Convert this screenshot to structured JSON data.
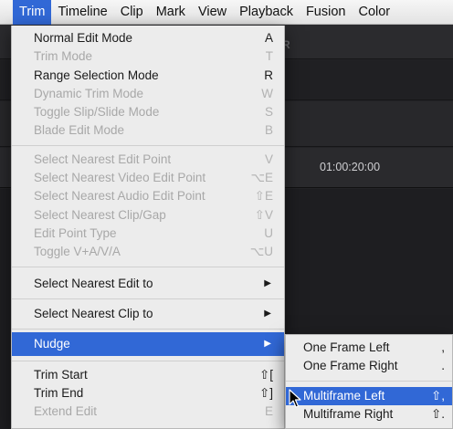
{
  "menubar": {
    "items": [
      "Trim",
      "Timeline",
      "Clip",
      "Mark",
      "View",
      "Playback",
      "Fusion",
      "Color"
    ],
    "active": "Trim"
  },
  "background": {
    "partial_label": "R",
    "timecode": "01:00:20:00"
  },
  "trim_menu": {
    "group1": [
      {
        "label": "Normal Edit Mode",
        "shortcut": "A",
        "enabled": true
      },
      {
        "label": "Trim Mode",
        "shortcut": "T",
        "enabled": false
      },
      {
        "label": "Range Selection Mode",
        "shortcut": "R",
        "enabled": true
      },
      {
        "label": "Dynamic Trim Mode",
        "shortcut": "W",
        "enabled": false
      },
      {
        "label": "Toggle Slip/Slide Mode",
        "shortcut": "S",
        "enabled": false
      },
      {
        "label": "Blade Edit Mode",
        "shortcut": "B",
        "enabled": false
      }
    ],
    "group2": [
      {
        "label": "Select Nearest Edit Point",
        "shortcut": "V",
        "enabled": false
      },
      {
        "label": "Select Nearest Video Edit Point",
        "shortcut": "⌥E",
        "enabled": false
      },
      {
        "label": "Select Nearest Audio Edit Point",
        "shortcut": "⇧E",
        "enabled": false
      },
      {
        "label": "Select Nearest Clip/Gap",
        "shortcut": "⇧V",
        "enabled": false
      },
      {
        "label": "Edit Point Type",
        "shortcut": "U",
        "enabled": false
      },
      {
        "label": "Toggle V+A/V/A",
        "shortcut": "⌥U",
        "enabled": false
      }
    ],
    "submenus": [
      {
        "label": "Select Nearest Edit to"
      },
      {
        "label": "Select Nearest Clip to"
      },
      {
        "label": "Nudge"
      }
    ],
    "group3": [
      {
        "label": "Trim Start",
        "shortcut": "⇧[",
        "enabled": true
      },
      {
        "label": "Trim End",
        "shortcut": "⇧]",
        "enabled": true
      },
      {
        "label": "Extend Edit",
        "shortcut": "E",
        "enabled": false
      }
    ]
  },
  "nudge_submenu": {
    "items": [
      {
        "label": "One Frame Left",
        "shortcut": ","
      },
      {
        "label": "One Frame Right",
        "shortcut": "."
      },
      {
        "label": "Multiframe Left",
        "shortcut": "⇧,"
      },
      {
        "label": "Multiframe Right",
        "shortcut": "⇧."
      }
    ]
  },
  "colors": {
    "menu_bg": "#ececec",
    "highlight": "#3168d6",
    "disabled_text": "#a8a8a8",
    "app_bg": "#232326"
  },
  "icons": {
    "submenu_arrow": "chevron-right-icon",
    "cursor": "mouse-pointer-icon"
  }
}
